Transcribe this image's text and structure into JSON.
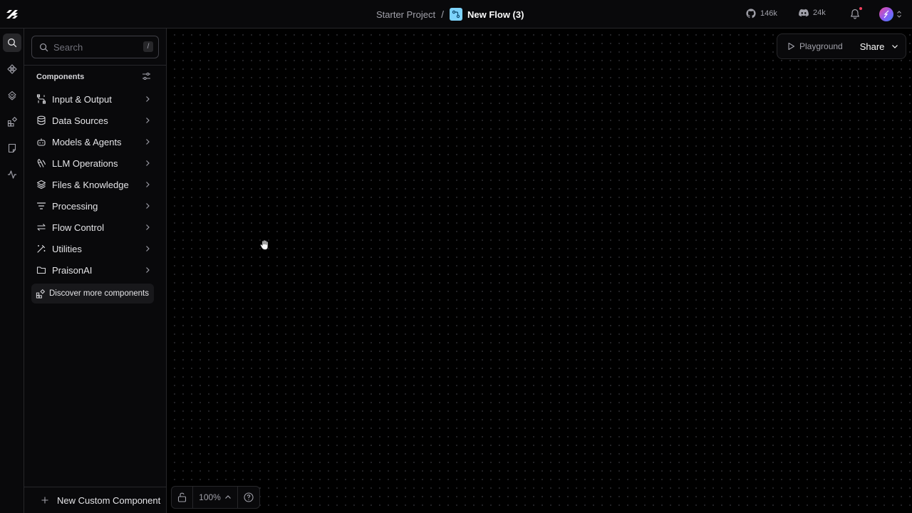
{
  "header": {
    "project": "Starter Project",
    "separator": "/",
    "flow_name": "New Flow (3)",
    "github_count": "146k",
    "discord_count": "24k"
  },
  "rail": {
    "items": [
      "search-icon",
      "components-icon",
      "bundles-icon",
      "store-icon",
      "notes-icon",
      "traces-icon"
    ]
  },
  "sidebar": {
    "search_placeholder": "Search",
    "search_shortcut": "/",
    "heading": "Components",
    "categories": [
      {
        "label": "Input & Output",
        "icon": "input-output-icon"
      },
      {
        "label": "Data Sources",
        "icon": "database-icon"
      },
      {
        "label": "Models & Agents",
        "icon": "bot-icon"
      },
      {
        "label": "LLM Operations",
        "icon": "brain-icon"
      },
      {
        "label": "Files & Knowledge",
        "icon": "layers-icon"
      },
      {
        "label": "Processing",
        "icon": "filter-icon"
      },
      {
        "label": "Flow Control",
        "icon": "arrows-icon"
      },
      {
        "label": "Utilities",
        "icon": "wand-icon"
      },
      {
        "label": "PraisonAI",
        "icon": "folder-icon"
      }
    ],
    "discover_label": "Discover more components",
    "new_custom_label": "New Custom Component"
  },
  "canvas": {
    "playground_label": "Playground",
    "share_label": "Share",
    "zoom_level": "100%"
  },
  "colors": {
    "background": "#09090b",
    "canvas": "#000000",
    "border": "#27272a",
    "flow_icon": "#7dd3fc",
    "notification_dot": "#f43f5e"
  }
}
